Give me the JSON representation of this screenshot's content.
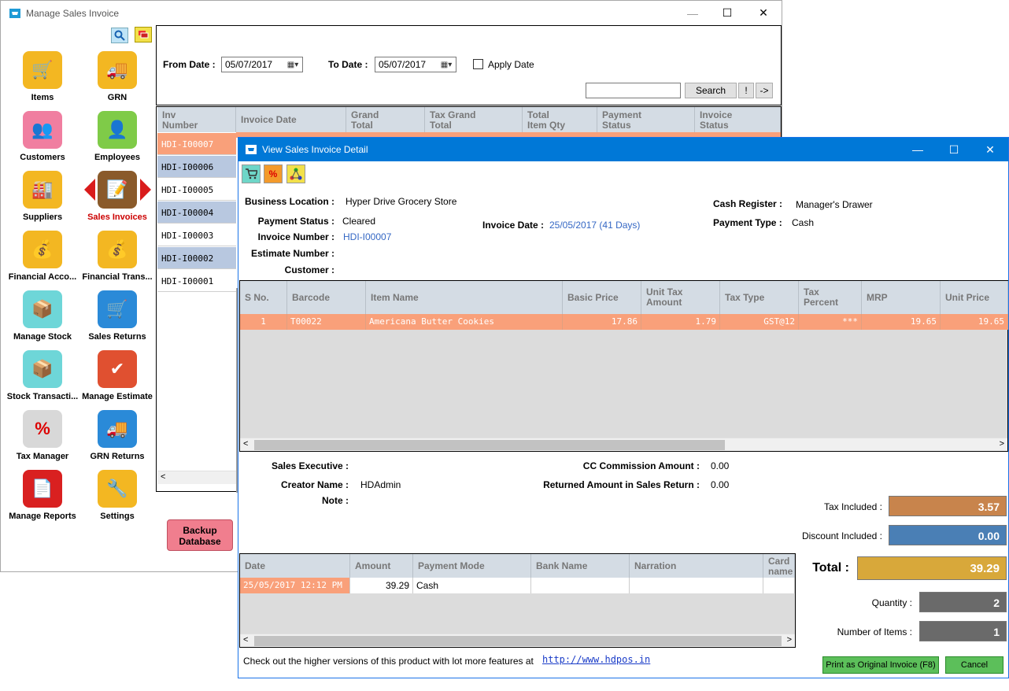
{
  "main_window": {
    "title": "Manage Sales Invoice",
    "minimize": "—",
    "maximize": "☐",
    "close": "✕"
  },
  "sidebar": {
    "items": [
      {
        "label": "Items",
        "icon": "cart-icon"
      },
      {
        "label": "GRN",
        "icon": "truck-icon"
      },
      {
        "label": "Customers",
        "icon": "customers-icon"
      },
      {
        "label": "Employees",
        "icon": "employee-icon"
      },
      {
        "label": "Suppliers",
        "icon": "factory-icon"
      },
      {
        "label": "Sales Invoices",
        "icon": "invoice-icon"
      },
      {
        "label": "Financial Acco...",
        "icon": "coins-icon"
      },
      {
        "label": "Financial Trans...",
        "icon": "coins-transfer-icon"
      },
      {
        "label": "Manage Stock",
        "icon": "stock-icon"
      },
      {
        "label": "Sales Returns",
        "icon": "return-cart-icon"
      },
      {
        "label": "Stock Transacti...",
        "icon": "stock-transaction-icon"
      },
      {
        "label": "Manage Estimate",
        "icon": "estimate-icon"
      },
      {
        "label": "Tax Manager",
        "icon": "percent-icon"
      },
      {
        "label": "GRN Returns",
        "icon": "truck-return-icon"
      },
      {
        "label": "Manage Reports",
        "icon": "reports-icon"
      },
      {
        "label": "Settings",
        "icon": "tools-icon"
      }
    ],
    "backup_button": "Backup\nDatabase"
  },
  "filter": {
    "from_date_label": "From Date :",
    "from_date_value": "05/07/2017",
    "to_date_label": "To Date :",
    "to_date_value": "05/07/2017",
    "apply_date_label": "Apply Date",
    "search_button": "Search",
    "bang_button": "!",
    "arrow_button": "->"
  },
  "invoice_grid": {
    "headers": [
      "Inv\nNumber",
      "Invoice Date",
      "Grand\nTotal",
      "Tax Grand\nTotal",
      "Total\nItem Qty",
      "Payment\nStatus",
      "Invoice\nStatus"
    ],
    "rows": [
      "HDI-I00007",
      "HDI-I00006",
      "HDI-I00005",
      "HDI-I00004",
      "HDI-I00003",
      "HDI-I00002",
      "HDI-I00001"
    ]
  },
  "detail": {
    "title": "View Sales Invoice Detail",
    "business_location_label": "Business Location :",
    "business_location": "Hyper Drive Grocery Store",
    "payment_status_label": "Payment Status :",
    "payment_status": "Cleared",
    "invoice_number_label": "Invoice Number :",
    "invoice_number": "HDI-I00007",
    "estimate_number_label": "Estimate Number :",
    "customer_label": "Customer :",
    "invoice_date_label": "Invoice Date :",
    "invoice_date": "25/05/2017 (41 Days)",
    "cash_register_label": "Cash Register :",
    "cash_register": "Manager's Drawer",
    "payment_type_label": "Payment Type :",
    "payment_type": "Cash",
    "items_headers": [
      "S No.",
      "Barcode",
      "Item Name",
      "Basic Price",
      "Unit Tax\nAmount",
      "Tax Type",
      "Tax\nPercent",
      "MRP",
      "Unit Price"
    ],
    "items_rows": [
      [
        "1",
        "T00022",
        "Americana Butter Cookies",
        "17.86",
        "1.79",
        "GST@12",
        "***",
        "19.65",
        "19.65"
      ]
    ],
    "sales_executive_label": "Sales Executive :",
    "creator_name_label": "Creator Name :",
    "creator_name": "HDAdmin",
    "note_label": "Note :",
    "cc_commission_label": "CC Commission Amount :",
    "cc_commission": "0.00",
    "returned_amount_label": "Returned Amount in Sales Return :",
    "returned_amount": "0.00",
    "payment_headers": [
      "Date",
      "Amount",
      "Payment Mode",
      "Bank Name",
      "Narration",
      "Card\nname"
    ],
    "payment_rows": [
      [
        "25/05/2017 12:12 PM",
        "39.29",
        "Cash",
        "",
        "",
        ""
      ]
    ],
    "tax_included_label": "Tax Included :",
    "tax_included": "3.57",
    "discount_included_label": "Discount Included :",
    "discount_included": "0.00",
    "total_label": "Total :",
    "total": "39.29",
    "quantity_label": "Quantity :",
    "quantity": "2",
    "number_of_items_label": "Number of Items :",
    "number_of_items": "1",
    "footer_text": "Check out the higher versions of this product with lot more features at",
    "footer_link": "http://www.hdpos.in",
    "print_button": "Print as Original Invoice (F8)",
    "cancel_button": "Cancel"
  },
  "colors": {
    "selected_row": "#f9a07a",
    "alt_row": "#b8c8e0",
    "tax_box": "#c8844c",
    "discount_box": "#4a7fb5",
    "total_box": "#d8a83a",
    "qty_box": "#6a6a6a",
    "title_blue": "#0078d7"
  }
}
